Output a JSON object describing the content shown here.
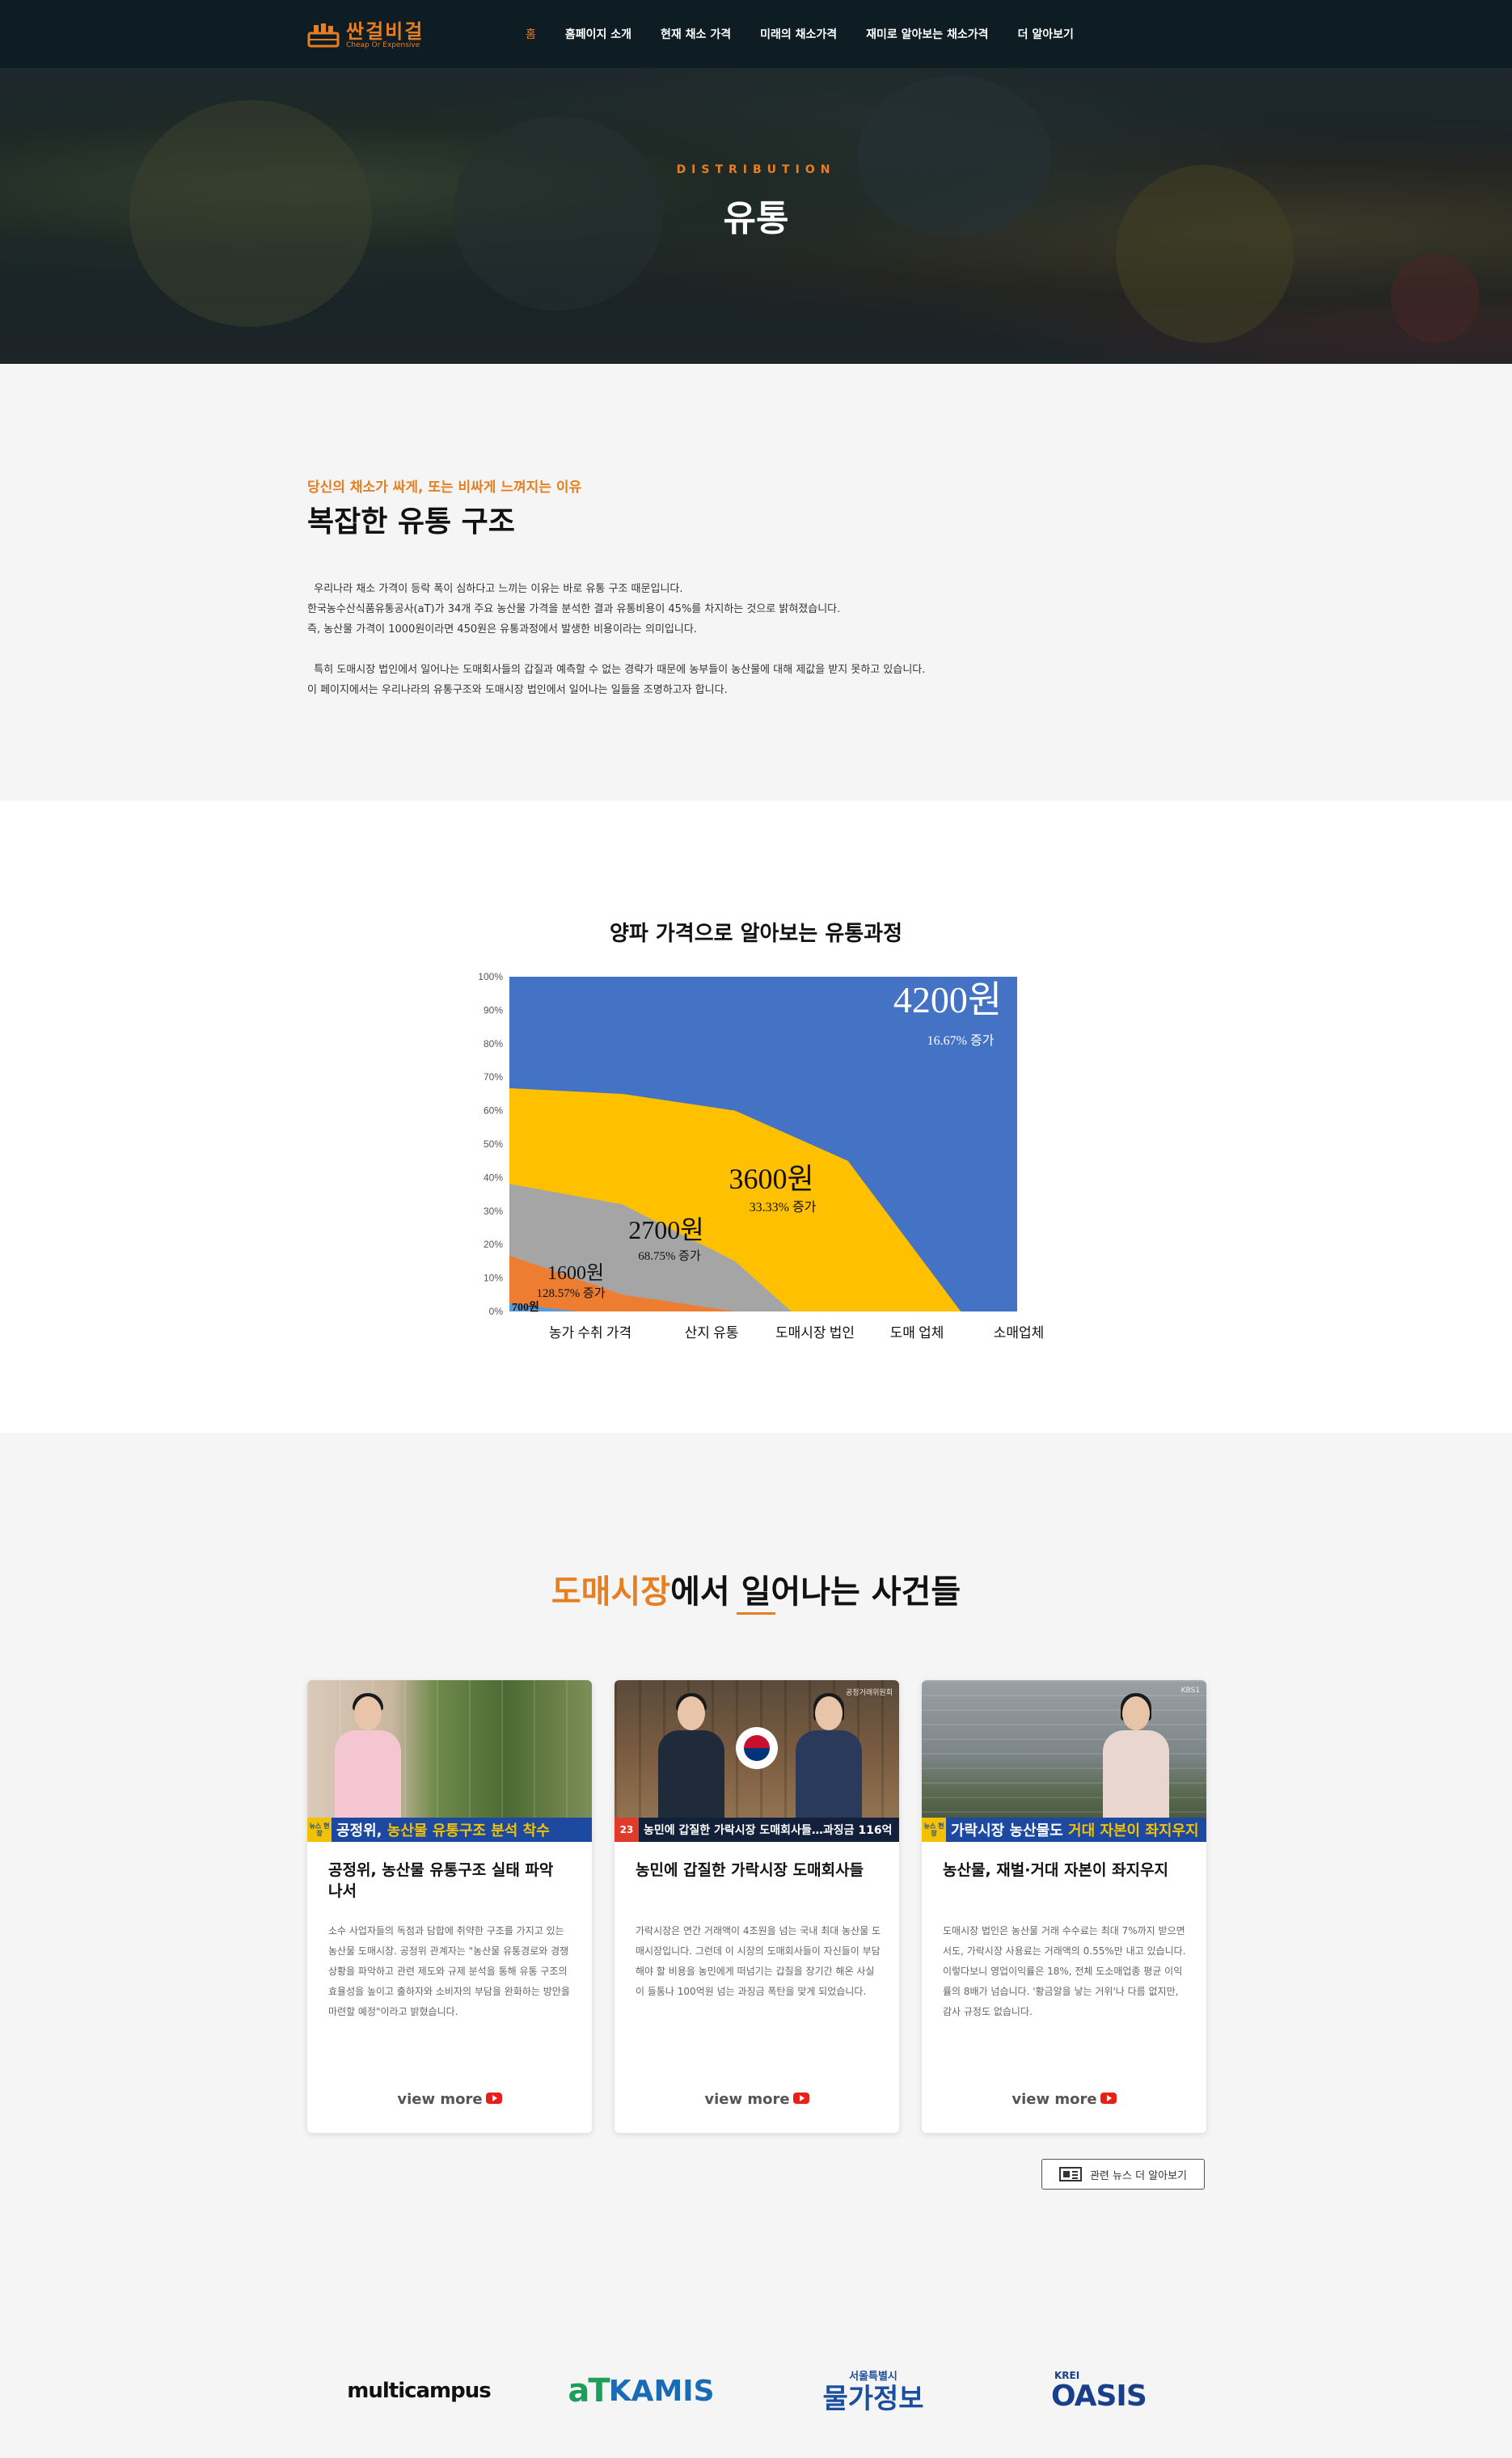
{
  "nav": {
    "logo_main": "싼걸비걸",
    "logo_sub": "Cheap Or Expensive",
    "items": [
      {
        "label": "홈",
        "active": true
      },
      {
        "label": "홈페이지 소개"
      },
      {
        "label": "현재 채소 가격"
      },
      {
        "label": "미래의 채소가격"
      },
      {
        "label": "재미로 알아보는 채소가격"
      },
      {
        "label": "더 알아보기"
      }
    ]
  },
  "hero": {
    "subtitle": "DISTRIBUTION",
    "title": "유통"
  },
  "intro": {
    "kicker": "당신의 채소가 싸게, 또는 비싸게 느껴지는 이유",
    "title": "복잡한 유통 구조",
    "paragraph1": [
      "  우리나라 채소 가격이 등락 폭이 심하다고 느끼는 이유는 바로 유통 구조 때문입니다.",
      "한국농수산식품유통공사(aT)가 34개 주요 농산물 가격을 분석한 결과 유통비용이 45%를 차지하는 것으로 밝혀졌습니다.",
      "즉, 농산물 가격이 1000원이라면 450원은 유통과정에서 발생한 비용이라는 의미입니다."
    ],
    "paragraph2": [
      "  특히 도매시장 법인에서 일어나는 도매회사들의 갑질과 예측할 수 없는 경략가 때문에 농부들이 농산물에 대해 제값을 받지 못하고 있습니다.",
      "이 페이지에서는 우리나라의 유통구조와 도매시장 법인에서 일어나는 일들을 조명하고자 합니다."
    ]
  },
  "chart_section": {
    "title": "양파 가격으로 알아보는 유통과정"
  },
  "chart_data": {
    "type": "area",
    "title": "양파 가격으로 알아보는 유통과정",
    "categories": [
      "농가 수취 가격",
      "산지 유통",
      "도매시장 법인",
      "도매 업체",
      "소매업체"
    ],
    "y_ticks": [
      "0%",
      "10%",
      "20%",
      "30%",
      "40%",
      "50%",
      "60%",
      "70%",
      "80%",
      "90%",
      "100%"
    ],
    "ylim": [
      0,
      100
    ],
    "series": [
      {
        "price": "4200원",
        "increase": "16.67% 증가",
        "color": "#4472c4"
      },
      {
        "price": "3600원",
        "increase": "33.33% 증가",
        "color": "#ffc000"
      },
      {
        "price": "2700원",
        "increase": "68.75% 증가",
        "color": "#a5a5a5"
      },
      {
        "price": "1600원",
        "increase": "128.57% 증가",
        "color": "#ed7d31"
      },
      {
        "price": "700원",
        "increase": "",
        "color": "#5b9bd5"
      }
    ],
    "boundaries": [
      {
        "x": [
          0,
          1,
          2,
          3,
          4,
          4.5
        ],
        "y": [
          66.7,
          65,
          60,
          45,
          0,
          0
        ]
      },
      {
        "x": [
          0,
          1,
          2,
          2.5,
          3,
          4.5
        ],
        "y": [
          38.1,
          32,
          15,
          0,
          0,
          0
        ]
      },
      {
        "x": [
          0,
          1,
          2,
          4.5
        ],
        "y": [
          16.7,
          5,
          0,
          0
        ]
      },
      {
        "x": [
          0,
          0.6,
          4.5
        ],
        "y": [
          2.5,
          0,
          0
        ]
      }
    ]
  },
  "events": {
    "title_accent": "도매시장",
    "title_rest": "에서 일어나는 사건들",
    "cards": [
      {
        "caption_tag": "뉴스 현장",
        "caption_plain": "공정위, ",
        "caption_highlight": "농산물 유통구조 분석 착수",
        "title": "공정위, 농산물 유통구조 실태 파악 나서",
        "body": "소수 사업자들의 독점과 담합에 취약한 구조를 가지고 있는 농산물 도매시장. 공정위 관계자는 \"농산물 유통경로와 경쟁상황을 파악하고 관련 제도와 규제 분석을 통해 유통 구조의 효율성을 높이고 출하자와 소비자의 부담을 완화하는 방안을 마련할 예정\"이라고 밝혔습니다.",
        "more": "view more"
      },
      {
        "caption_tag": "23",
        "caption_plain": "농민에 갑질한 가락시장 도매회사들…과징금 116억",
        "caption_highlight": "",
        "news_logo": "공정거래위원회",
        "title": "농민에 갑질한 가락시장 도매회사들",
        "body": "가락시장은 연간 거래액이 4조원을 넘는 국내 최대 농산물 도매시장입니다. 그런데 이 시장의 도매회사들이 자신들이 부담해야 할 비용을 농민에게 떠넘기는 갑질을 장기간 해온 사실이 들통나 100억원 넘는 과징금 폭탄을 맞게 되었습니다.",
        "more": "view more"
      },
      {
        "caption_tag": "뉴스 현장",
        "caption_plain": "가락시장 농산물도 ",
        "caption_highlight": "거대 자본이 좌지우지",
        "news_logo": "KBS1",
        "title": "농산물, 재벌·거대 자본이 좌지우지",
        "body": "도매시장 법인은 농산물 거래 수수료는 최대 7%까지 받으면서도, 가락시장 사용료는 거래액의 0.55%만 내고 있습니다. 이렇다보니 영업이익률은 18%, 전체 도소매업종 평균 이익률의 8배가 넘습니다. '황금알을 낳는 거위'나 다름 없지만, 감사 규정도 없습니다.",
        "more": "view more"
      }
    ],
    "more_news": "관련 뉴스 더 알아보기"
  },
  "partners": {
    "multicampus": "multicampus",
    "at": "aT",
    "kamis": "KAMIS",
    "seoul_small": "서울특별시",
    "seoul_big": "물가정보",
    "krei": "KREI",
    "oasis": "OASIS"
  }
}
